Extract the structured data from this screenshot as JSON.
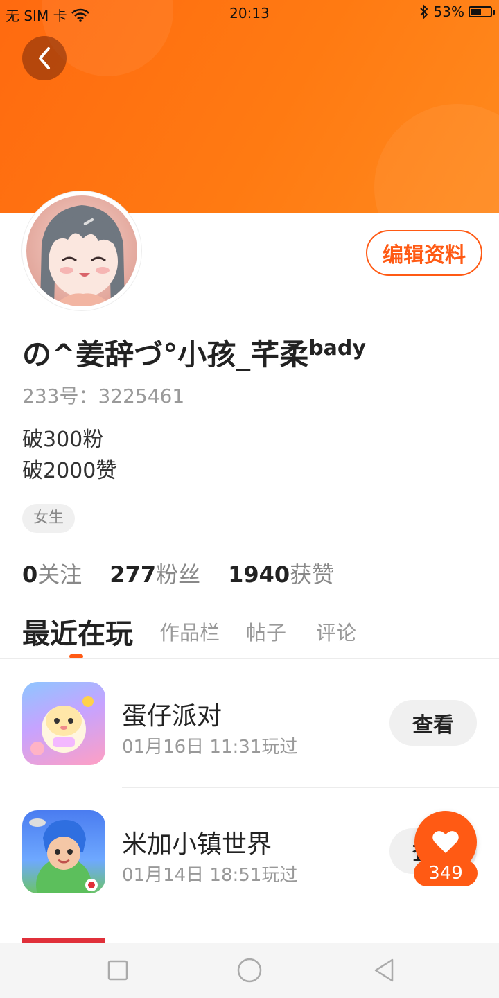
{
  "status_bar": {
    "carrier": "无 SIM 卡",
    "time": "20:13",
    "battery_percent": "53%",
    "battery_level": 0.53
  },
  "header": {
    "back_icon": "chevron-left-icon"
  },
  "profile": {
    "edit_button": "编辑资料",
    "username": "の^姜辞づ°小孩_芊柔",
    "username_sup": "bady",
    "uid": "233号：3225461",
    "bio_lines": [
      "破300粉",
      "破2000赞"
    ],
    "gender_tag": "女生",
    "stats": [
      {
        "num": "0",
        "label": "关注"
      },
      {
        "num": "277",
        "label": "粉丝"
      },
      {
        "num": "1940",
        "label": "获赞"
      }
    ]
  },
  "tabs": [
    {
      "label": "最近在玩",
      "active": true
    },
    {
      "label": "作品栏",
      "active": false
    },
    {
      "label": "帖子",
      "active": false
    },
    {
      "label": "评论",
      "active": false
    }
  ],
  "games": [
    {
      "name": "蛋仔派对",
      "played": "01月16日 11:31玩过",
      "button": "查看"
    },
    {
      "name": "米加小镇世界",
      "played": "01月14日 18:51玩过",
      "button": "查看"
    }
  ],
  "like_fab": {
    "icon": "heart-icon",
    "count": "349"
  },
  "colors": {
    "accent": "#ff5a14",
    "banner": "#ff7a12"
  },
  "nav_bar": {
    "icons": [
      "square-icon",
      "circle-icon",
      "triangle-back-icon"
    ]
  }
}
